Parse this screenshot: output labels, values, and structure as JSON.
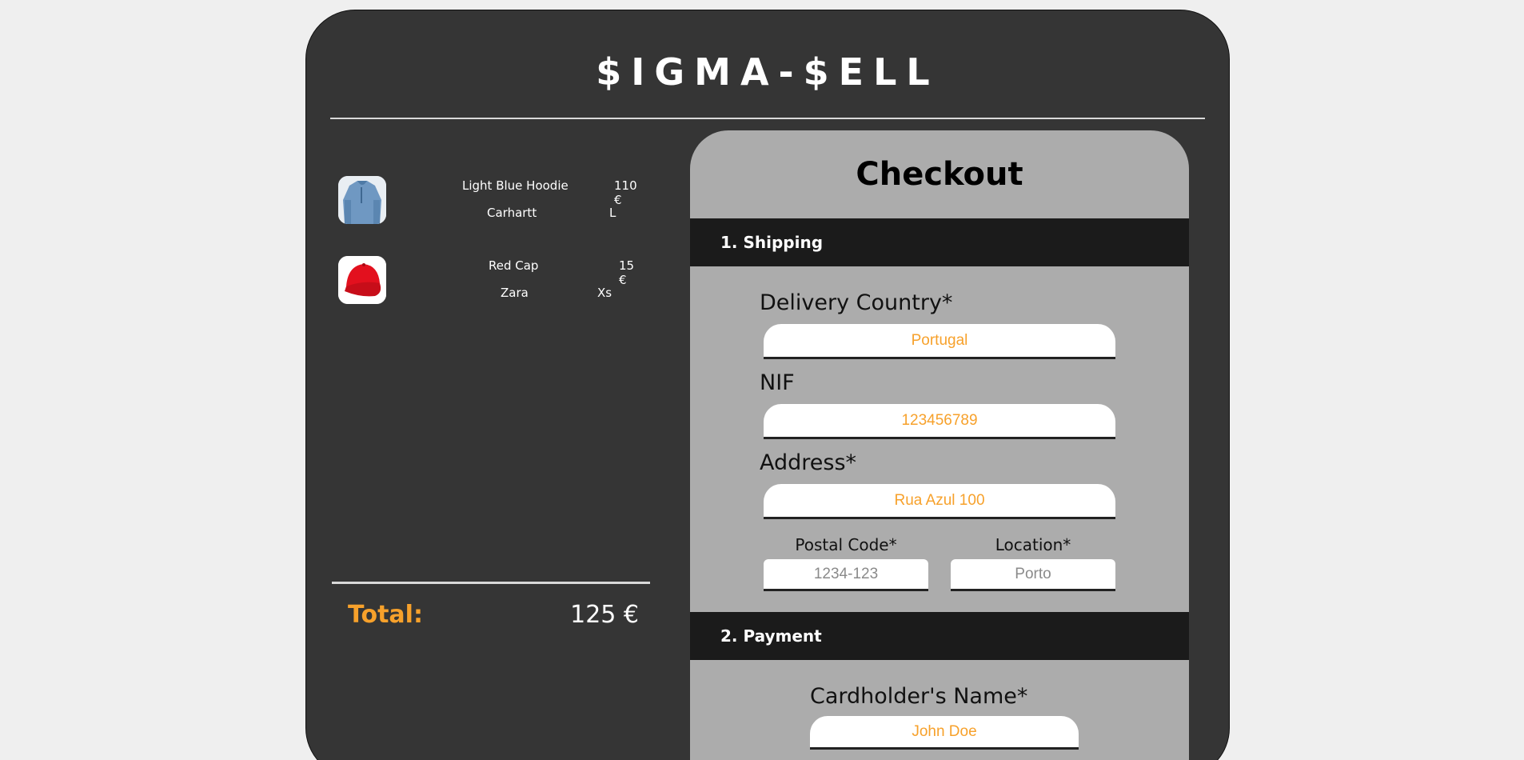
{
  "brand": "$IGMA-$ELL",
  "cart": {
    "items": [
      {
        "name": "Light Blue Hoodie",
        "price": "110 €",
        "brand": "Carhartt",
        "size": "L",
        "icon": "hoodie-image"
      },
      {
        "name": "Red Cap",
        "price": "15 €",
        "brand": "Zara",
        "size": "Xs",
        "icon": "cap-image"
      }
    ],
    "total_label": "Total:",
    "total_value": "125 €"
  },
  "checkout": {
    "title": "Checkout",
    "shipping": {
      "heading": "1. Shipping",
      "country_label": "Delivery Country*",
      "country_value": "Portugal",
      "nif_label": "NIF",
      "nif_value": "123456789",
      "address_label": "Address*",
      "address_value": "Rua Azul 100",
      "postal_label": "Postal Code*",
      "postal_placeholder": "1234-123",
      "location_label": "Location*",
      "location_placeholder": "Porto"
    },
    "payment": {
      "heading": "2. Payment",
      "name_label": "Cardholder's Name*",
      "name_value": "John Doe"
    }
  },
  "colors": {
    "accent": "#f7a12b",
    "shell": "#353535",
    "panel": "#acacac",
    "bar": "#1b1b1b"
  }
}
